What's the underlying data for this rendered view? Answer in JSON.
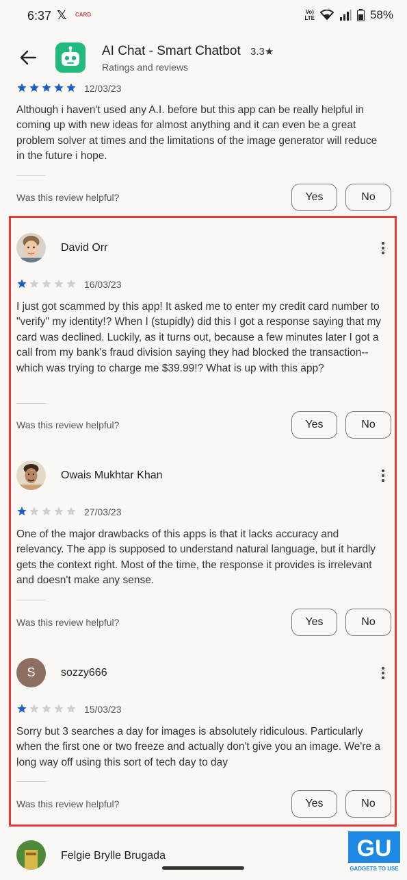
{
  "status_bar": {
    "time": "6:37",
    "x_glyph": "𝕏",
    "carrier_badge": "CARD",
    "network_label": "Vo) LTE",
    "battery_percent": "58%",
    "icons": [
      "x-logo-icon",
      "volte-icon",
      "wifi-icon",
      "signal-icon",
      "battery-icon"
    ]
  },
  "app_header": {
    "title": "AI Chat - Smart Chatbot",
    "rating": "3.3★",
    "subtitle": "Ratings and reviews",
    "icon": "robot-app-icon"
  },
  "colors": {
    "star_filled": "#1a5fc8",
    "star_empty": "#d0d0d0",
    "highlight": "#e53935",
    "app_icon_bg": "#1fba7c",
    "avatar_s_bg": "#8d6e63"
  },
  "helpful_prompt": "Was this review helpful?",
  "yes_label": "Yes",
  "no_label": "No",
  "reviews": [
    {
      "reviewer": "",
      "stars": 5,
      "date": "12/03/23",
      "text": "Although i haven't used any A.I. before but this app can be really helpful in coming up with new ideas for almost anything and it can even be a great problem solver at times and the limitations of the image generator will reduce in the future i hope."
    },
    {
      "reviewer": "David Orr",
      "stars": 1,
      "date": "16/03/23",
      "text": "I just got scammed by this app! It asked me to enter my credit card number to \"verify\" my identity!? When I (stupidly) did this I got a response saying that my card was declined. Luckily, as it turns out, because a few minutes later I got a call from my bank's fraud division saying they had blocked the transaction--which was trying to charge me $39.99!? What is up with this app?"
    },
    {
      "reviewer": "Owais Mukhtar Khan",
      "stars": 1,
      "date": "27/03/23",
      "text": "One of the major drawbacks of this apps is that it lacks accuracy and relevancy. The app is supposed to understand natural language, but it hardly gets the context right. Most of the time, the response it provides is irrelevant and doesn't make any sense."
    },
    {
      "reviewer": "sozzy666",
      "avatar_letter": "S",
      "stars": 1,
      "date": "15/03/23",
      "text": "Sorry but 3 searches a day for images is absolutely ridiculous. Particularly when the first one or two freeze and actually don't give you an image. We're a long way off using this sort of tech day to day"
    },
    {
      "reviewer": "Felgie Brylle Brugada"
    }
  ],
  "watermark": {
    "logo_text": "GU",
    "caption": "GADGETS TO USE"
  }
}
